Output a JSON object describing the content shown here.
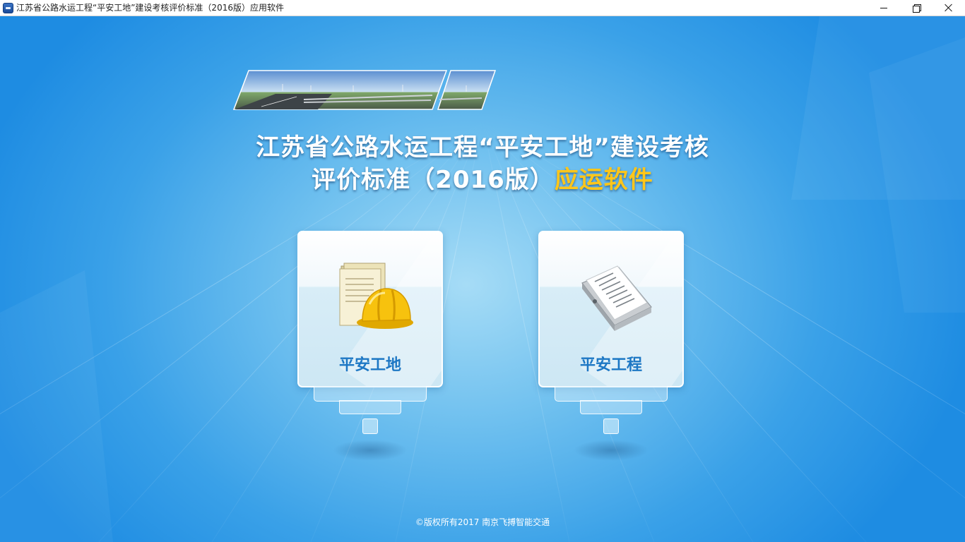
{
  "window": {
    "title": "江苏省公路水运工程“平安工地”建设考核评价标准（2016版）应用软件",
    "minimize_label": "minimize",
    "maximize_label": "restore",
    "close_label": "close"
  },
  "header": {
    "title_line1": "江苏省公路水运工程“平安工地”建设考核",
    "title_line2_main": "评价标准（2016版）",
    "title_line2_accent": "应运软件",
    "accent_color": "#ffc61a"
  },
  "cards": [
    {
      "label": "平安工地",
      "icon": "hard-hat-documents-icon"
    },
    {
      "label": "平安工程",
      "icon": "binder-document-icon"
    }
  ],
  "footer": {
    "copyright": "©版权所有2017 南京飞搏智能交通"
  },
  "colors": {
    "background": "#3aa1e8",
    "card_label": "#1d77c4",
    "title_text": "#ffffff"
  }
}
